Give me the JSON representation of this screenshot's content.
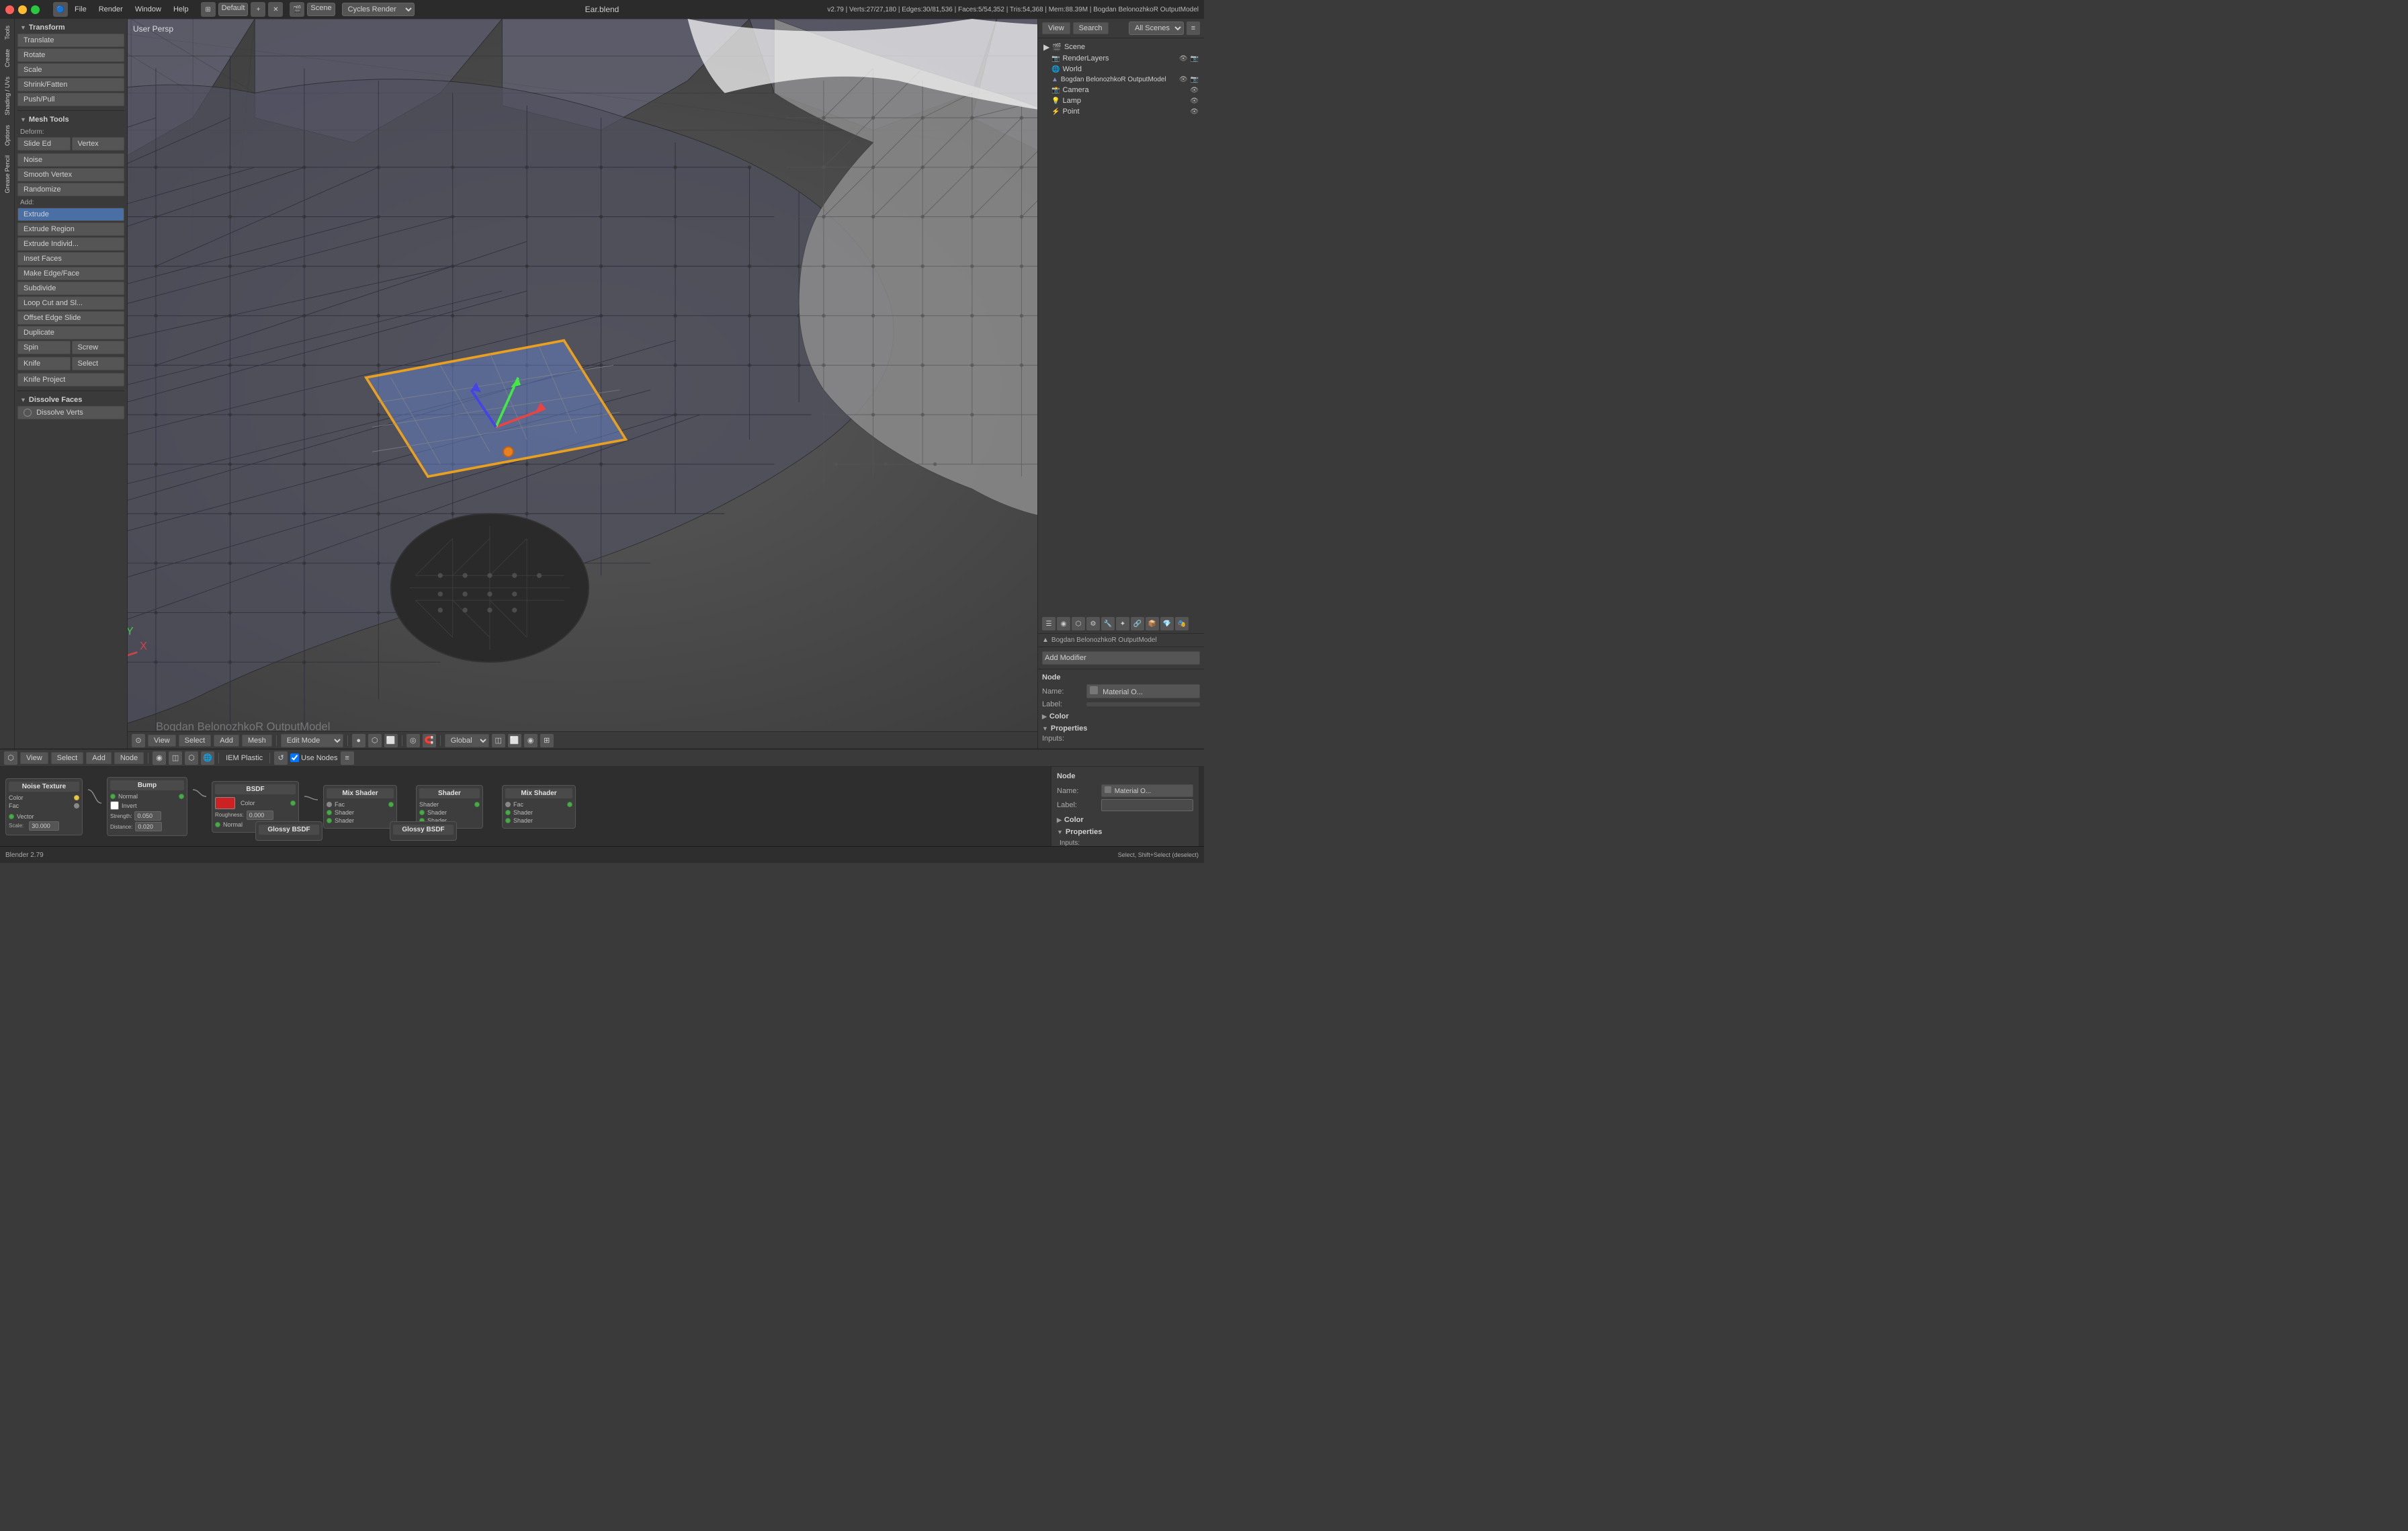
{
  "titlebar": {
    "title": "Ear.blend",
    "menu": [
      "Blender",
      "File",
      "Render",
      "Window",
      "Help"
    ]
  },
  "workspace": {
    "layout": "Default",
    "scene": "Scene",
    "engine": "Cycles Render"
  },
  "stats": {
    "text": "v2.79 | Verts:27/27,180 | Edges:30/81,536 | Faces:5/54,352 | Tris:54,368 | Mem:88.39M | Bogdan BelonozhkoR OutputModel"
  },
  "viewport": {
    "label": "User Persp",
    "mode": "Edit Mode",
    "pivot": "Global",
    "toolbar": {
      "view": "View",
      "select": "Select",
      "add": "Add",
      "mesh": "Mesh",
      "mode": "Edit Mode"
    }
  },
  "left_panel": {
    "transform": {
      "header": "Transform",
      "buttons": [
        "Translate",
        "Rotate",
        "Scale",
        "Shrink/Fatten",
        "Push/Pull"
      ]
    },
    "mesh_tools": {
      "header": "Mesh Tools",
      "deform_label": "Deform:",
      "deform_buttons": [
        "Slide Ed",
        "Vertex"
      ],
      "noise": "Noise",
      "smooth_vertex": "Smooth Vertex",
      "randomize": "Randomize",
      "add_label": "Add:",
      "extrude": "Extrude",
      "extrude_region": "Extrude Region",
      "extrude_indivd": "Extrude Individ...",
      "inset_faces": "Inset Faces",
      "make_edge_face": "Make Edge/Face",
      "subdivide": "Subdivide",
      "loop_cut": "Loop Cut and Sl...",
      "offset_edge": "Offset Edge Slide",
      "duplicate": "Duplicate",
      "spin": "Spin",
      "screw": "Screw",
      "knife": "Knife",
      "select": "Select",
      "knife_project": "Knife Project"
    },
    "dissolve": {
      "header": "Dissolve Faces",
      "dissolve_verts": "Dissolve Verts"
    }
  },
  "right_panel": {
    "header_buttons": [
      "View",
      "Search",
      "All Scenes"
    ],
    "scene_tree": [
      {
        "label": "Scene",
        "level": 0,
        "icon": "scene"
      },
      {
        "label": "RenderLayers",
        "level": 1,
        "icon": "render"
      },
      {
        "label": "World",
        "level": 1,
        "icon": "world"
      },
      {
        "label": "Bogdan BelonozhkoR OutputModel",
        "level": 1,
        "icon": "object"
      },
      {
        "label": "Camera",
        "level": 1,
        "icon": "camera"
      },
      {
        "label": "Lamp",
        "level": 1,
        "icon": "lamp"
      },
      {
        "label": "Point",
        "level": 1,
        "icon": "point"
      }
    ],
    "object_label": "Bogdan BelonozhkoR OutputModel",
    "add_modifier": "Add Modifier",
    "node": {
      "header": "Node",
      "name_label": "Name:",
      "name_value": "Material O...",
      "label_label": "Label:",
      "color_header": "Color",
      "properties_header": "Properties",
      "inputs_label": "Inputs:"
    }
  },
  "node_editor": {
    "nodes": [
      {
        "title": "Noise Texture",
        "sockets_out": [
          "Color",
          "Fac"
        ],
        "sockets_in": [
          "Vector"
        ],
        "fields": [
          {
            "label": "Scale:",
            "value": "30.000"
          }
        ]
      },
      {
        "title": "Bump",
        "sockets_in": [
          "Normal",
          "Strength:",
          "Distance:"
        ],
        "fields": [
          {
            "label": "Strength:",
            "value": "0.050"
          },
          {
            "label": "Distance:",
            "value": "0.020"
          }
        ],
        "checkboxes": [
          {
            "label": "Invert"
          }
        ]
      },
      {
        "title": "BSDF",
        "sockets_in": [
          "Color",
          "Roughness:",
          "Normal"
        ],
        "color_swatch": true,
        "fields": [
          {
            "label": "Roughness:",
            "value": "0.000"
          }
        ]
      },
      {
        "title": "Mix Shader",
        "sockets_in": [
          "Fac",
          "Shader",
          "Shader"
        ],
        "sockets_out": [
          "Shader"
        ]
      },
      {
        "title": "Shader",
        "sockets_out": [
          "Shader"
        ]
      },
      {
        "title": "Mix Shader",
        "sockets_in": [
          "Fac",
          "Shader",
          "Shader"
        ],
        "sockets_out": [
          "Shader"
        ]
      },
      {
        "title": "Glossy BSDF",
        "label": "Glossy BSDF"
      },
      {
        "title": "Glossy BSDF",
        "label": "Glossy BSDF"
      }
    ],
    "material": "IEM Plastic",
    "use_nodes": "Use Nodes"
  },
  "vtabs": [
    "Tools",
    "Create",
    "Shading / UVs",
    "Options",
    "Grease Pencil"
  ]
}
